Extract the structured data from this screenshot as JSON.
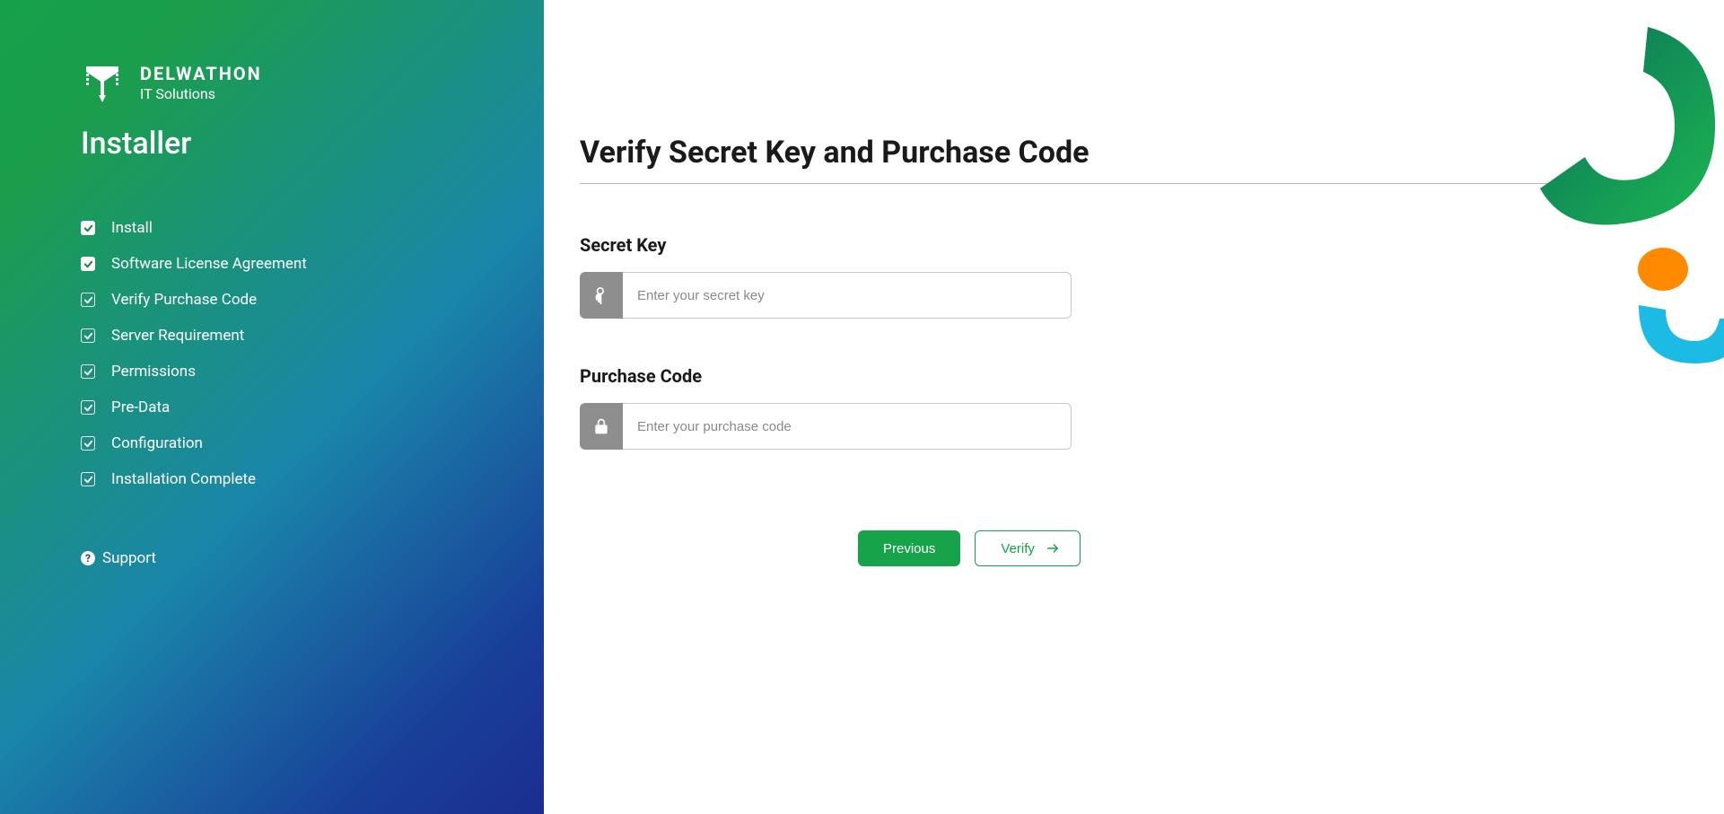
{
  "brand": {
    "name": "DELWATHON",
    "subtitle": "IT Solutions"
  },
  "sidebar": {
    "title": "Installer",
    "steps": [
      {
        "label": "Install",
        "state": "done"
      },
      {
        "label": "Software License Agreement",
        "state": "done"
      },
      {
        "label": "Verify Purchase Code",
        "state": "pending"
      },
      {
        "label": "Server Requirement",
        "state": "pending"
      },
      {
        "label": "Permissions",
        "state": "pending"
      },
      {
        "label": "Pre-Data",
        "state": "pending"
      },
      {
        "label": "Configuration",
        "state": "pending"
      },
      {
        "label": "Installation Complete",
        "state": "pending"
      }
    ],
    "support_label": "Support"
  },
  "main": {
    "title": "Verify Secret Key and Purchase Code",
    "secret_key": {
      "label": "Secret Key",
      "placeholder": "Enter your secret key",
      "value": ""
    },
    "purchase_code": {
      "label": "Purchase Code",
      "placeholder": "Enter your purchase code",
      "value": ""
    },
    "previous_label": "Previous",
    "verify_label": "Verify"
  }
}
